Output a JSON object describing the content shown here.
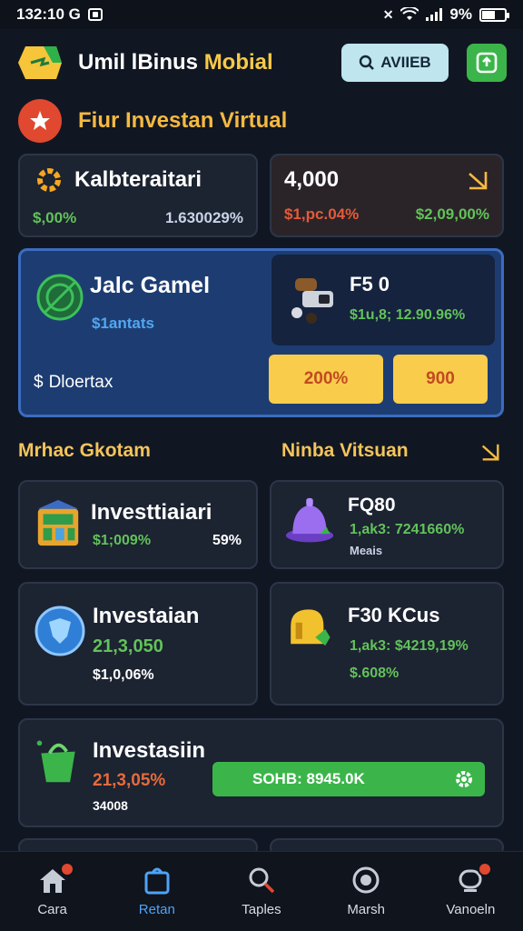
{
  "status_bar": {
    "time": "132:10 G",
    "battery_text": "9%"
  },
  "header": {
    "title_main": "Umil lBinus ",
    "title_accent": "Mobial",
    "search_label": "AVIIEB"
  },
  "section": {
    "title": "Fiur Investan Virtual"
  },
  "stats": [
    {
      "title": "Kalbteraitari",
      "left": "$,00%",
      "right": "1.630029%",
      "left_color": "#62c25a",
      "right_color": "#c9d3e6"
    },
    {
      "title": "4,000",
      "left": "$1,pc.04%",
      "right": "$2,09,00%",
      "left_color": "#e55a3a",
      "right_color": "#62c25a"
    }
  ],
  "featured": {
    "title": "Jalc Gamel",
    "subtitle": "$1antats",
    "footer": "Dloertax",
    "item_title": "F5 0",
    "item_value": "$1u,8; 12.90.96%",
    "button_a": "200%",
    "button_b": "900"
  },
  "rows": {
    "left_head": "Mrhac Gkotam",
    "right_head": "Ninba Vitsuan"
  },
  "investments": [
    {
      "title": "Investtiaiari",
      "line1": "$1;009%",
      "line1_extra": "59%",
      "line2": ""
    },
    {
      "title": "FQ80",
      "line1": "1,ak3: 7241660%",
      "line1_extra": "",
      "line2": "Meais"
    },
    {
      "title": "Investaian",
      "line1": "21,3,050",
      "line1_extra": "",
      "line2": "$1,0,06%"
    },
    {
      "title": "F30 KCus",
      "line1": "1,ak3: $4219,19%",
      "line1_extra": "",
      "line2": "$.608%"
    },
    {
      "title": "Investasiin",
      "line1": "21,3,05%",
      "line1_extra": "",
      "line2": "34008"
    }
  ],
  "wide_button": {
    "label": "SOHB: 8945.0K"
  },
  "nav": [
    {
      "label": "Cara",
      "icon": "home-icon"
    },
    {
      "label": "Retan",
      "icon": "bag-icon"
    },
    {
      "label": "Taples",
      "icon": "search-icon"
    },
    {
      "label": "Marsh",
      "icon": "gauge-icon"
    },
    {
      "label": "Vanoeln",
      "icon": "support-icon"
    }
  ],
  "colors": {
    "background": "#111722",
    "accent_yellow": "#f5b942",
    "accent_blue": "#4ea3f5",
    "accent_green": "#3bb54a",
    "accent_red": "#e0482f"
  }
}
